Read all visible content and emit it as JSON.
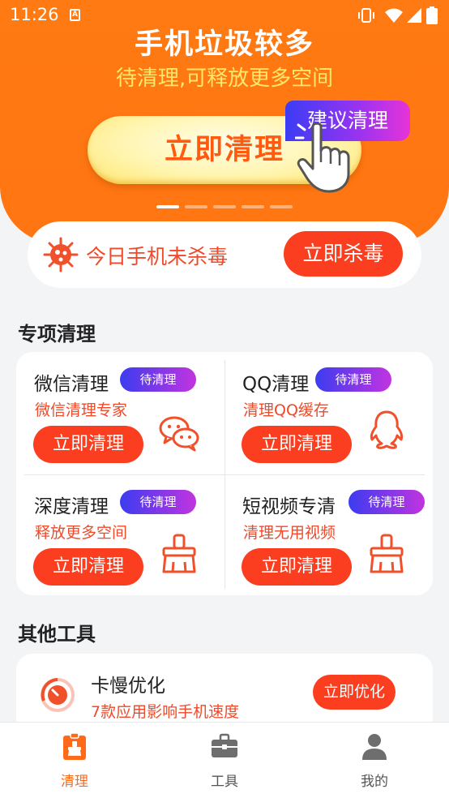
{
  "status_bar": {
    "time": "11:26",
    "app_icon_letter": "A"
  },
  "hero": {
    "title": "手机垃圾较多",
    "subtitle": "待清理,可释放更多空间",
    "clean_button": "立即清理",
    "suggest_tag": "建议清理",
    "carousel_pages": 5,
    "carousel_active": 1
  },
  "virus": {
    "text": "今日手机未杀毒",
    "button": "立即杀毒"
  },
  "special_section": {
    "title": "专项清理",
    "items": [
      {
        "title": "微信清理",
        "badge": "待清理",
        "desc": "微信清理专家",
        "button": "立即清理",
        "icon": "wechat-icon"
      },
      {
        "title": "QQ清理",
        "badge": "待清理",
        "desc": "清理QQ缓存",
        "button": "立即清理",
        "icon": "qq-penguin-icon"
      },
      {
        "title": "深度清理",
        "badge": "待清理",
        "desc": "释放更多空间",
        "button": "立即清理",
        "icon": "broom-icon"
      },
      {
        "title": "短视频专清",
        "badge": "待清理",
        "desc": "清理无用视频",
        "button": "立即清理",
        "icon": "broom-icon"
      }
    ]
  },
  "tools_section": {
    "title": "其他工具",
    "items": [
      {
        "title": "卡慢优化",
        "desc": "7款应用影响手机速度",
        "button": "立即优化",
        "icon": "speedometer-icon"
      }
    ]
  },
  "bottom_nav": {
    "active": 0,
    "items": [
      {
        "label": "清理",
        "icon": "clean-icon"
      },
      {
        "label": "工具",
        "icon": "toolbox-icon"
      },
      {
        "label": "我的",
        "icon": "user-icon"
      }
    ]
  },
  "colors": {
    "brand_orange": "#ff7a12",
    "accent_red": "#fa3e1f",
    "desc_red": "#ef4a2a",
    "subtitle_yellow": "#ffe86a",
    "badge_gradient_start": "#3c3cf0",
    "badge_gradient_end": "#c234e0",
    "nav_active": "#ff6a1a"
  }
}
